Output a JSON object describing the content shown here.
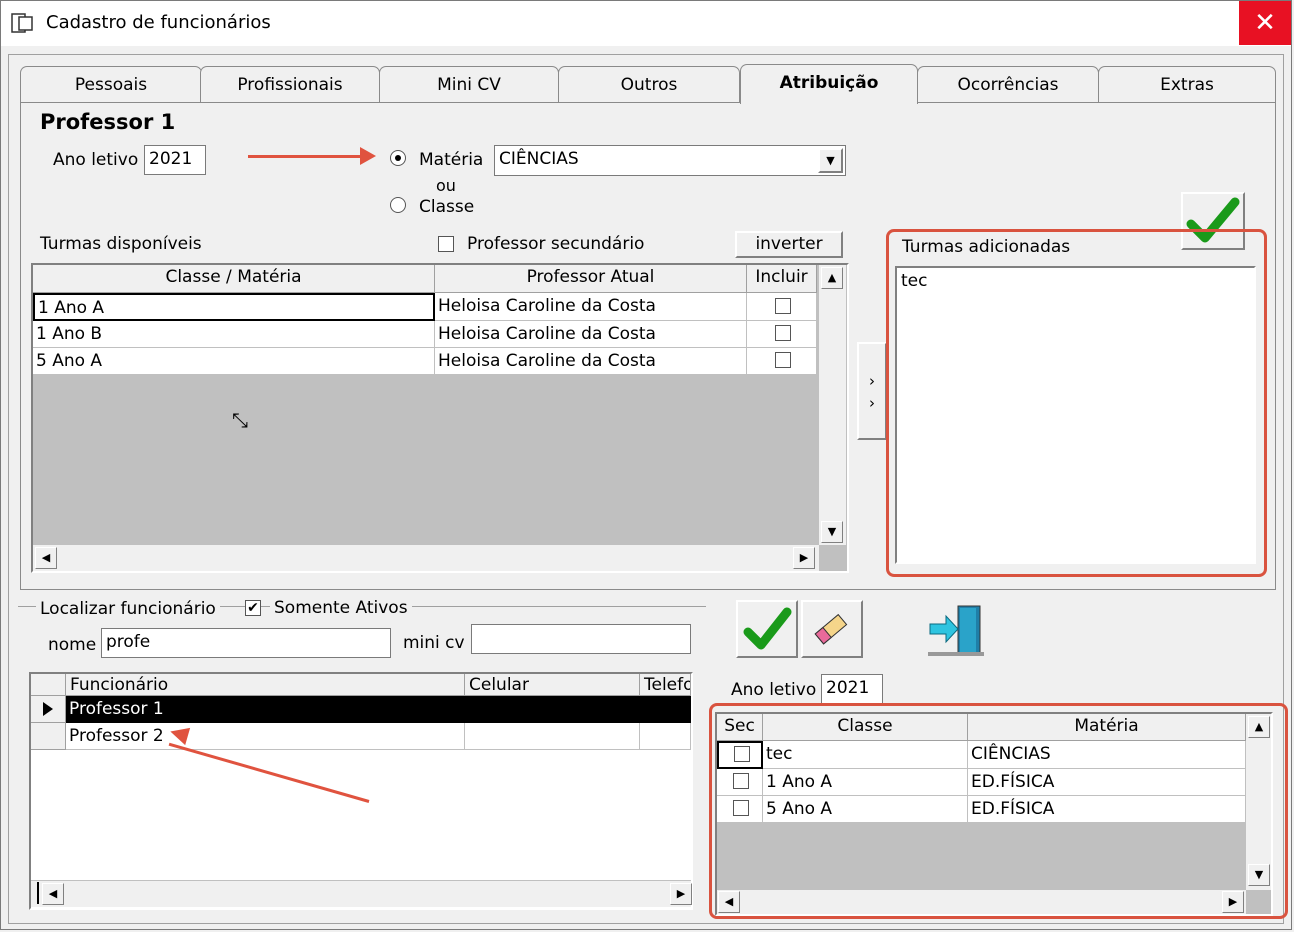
{
  "window": {
    "title": "Cadastro de funcionários",
    "close": "✕"
  },
  "tabs": [
    "Pessoais",
    "Profissionais",
    "Mini CV",
    "Outros",
    "Atribuição",
    "Ocorrências",
    "Extras"
  ],
  "active_tab": "Atribuição",
  "assign": {
    "heading": "Professor 1",
    "ano_label": "Ano letivo",
    "ano_value": "2021",
    "radio_materia": "Matéria",
    "ou": "ou",
    "radio_classe": "Classe",
    "materia_value": "CIÊNCIAS",
    "turmas_disp_label": "Turmas disponíveis",
    "prof_sec_label": "Professor secundário",
    "inverter": "inverter",
    "grid_headers": [
      "Classe / Matéria",
      "Professor Atual",
      "Incluir"
    ],
    "rows": [
      {
        "classe": "1 Ano A",
        "prof": "Heloisa Caroline da Costa"
      },
      {
        "classe": "1 Ano B",
        "prof": "Heloisa Caroline da Costa"
      },
      {
        "classe": "5 Ano A",
        "prof": "Heloisa Caroline da Costa"
      }
    ],
    "move_button": "> >",
    "turmas_add_label": "Turmas adicionadas",
    "turmas_add_items": [
      "tec"
    ]
  },
  "search": {
    "group_label": "Localizar funcionário",
    "somente_ativos": "Somente Ativos",
    "nome_label": "nome",
    "nome_value": "profe",
    "minicv_label": "mini cv",
    "minicv_value": "",
    "headers": [
      "Funcionário",
      "Celular",
      "Telefo"
    ],
    "rows": [
      {
        "name": "Professor 1",
        "selected": true
      },
      {
        "name": "Professor 2",
        "selected": false
      }
    ]
  },
  "bottom": {
    "ano_label": "Ano letivo",
    "ano_value": "2021",
    "headers": [
      "Sec",
      "Classe",
      "Matéria"
    ],
    "rows": [
      {
        "classe": "tec",
        "materia": "CIÊNCIAS"
      },
      {
        "classe": "1 Ano A",
        "materia": "ED.FÍSICA"
      },
      {
        "classe": "5 Ano A",
        "materia": "ED.FÍSICA"
      }
    ]
  },
  "colors": {
    "accent_red": "#d9533f",
    "check_green": "#1a9a1a",
    "close_red": "#e81123"
  }
}
